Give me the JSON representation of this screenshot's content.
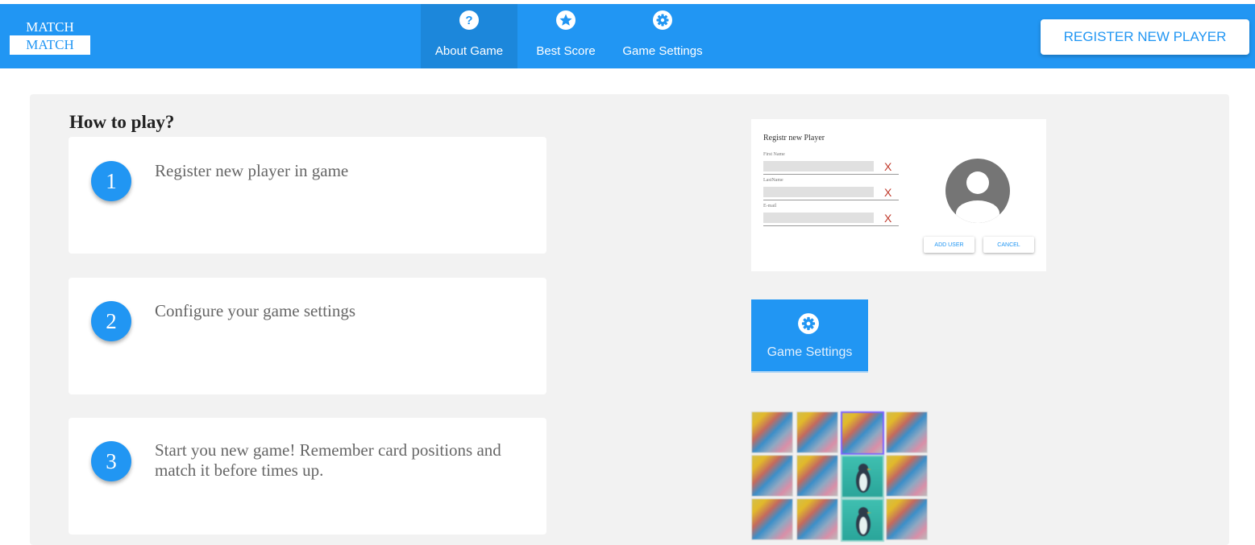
{
  "logo": {
    "line1": "MATCH",
    "line2": "MATCH"
  },
  "nav": [
    {
      "label": "About Game",
      "icon": "help-circle-icon",
      "active": true
    },
    {
      "label": "Best Score",
      "icon": "star-circle-icon",
      "active": false
    },
    {
      "label": "Game Settings",
      "icon": "gear-icon",
      "active": false
    }
  ],
  "header": {
    "register_label": "REGISTER NEW PLAYER"
  },
  "main": {
    "title": "How to play?",
    "steps": [
      {
        "number": "1",
        "text": "Register new player in game"
      },
      {
        "number": "2",
        "text": "Configure your game settings"
      },
      {
        "number": "3",
        "text": "Start you new game! Remember card positions and match it before times up."
      }
    ]
  },
  "preview_register": {
    "title": "Registr new Player",
    "fields": [
      {
        "label": "First Name",
        "clear": "X"
      },
      {
        "label": "LastName",
        "clear": "X"
      },
      {
        "label": "E-mail",
        "clear": "X"
      }
    ],
    "add_label": "ADD USER",
    "cancel_label": "CANCEL"
  },
  "preview_settings": {
    "label": "Game Settings",
    "icon": "gear-icon"
  },
  "preview_board": {
    "rows": 3,
    "cols": 4
  },
  "colors": {
    "primary": "#2196f3",
    "active_tab": "#1c87db",
    "panel": "#f2f2f2"
  }
}
